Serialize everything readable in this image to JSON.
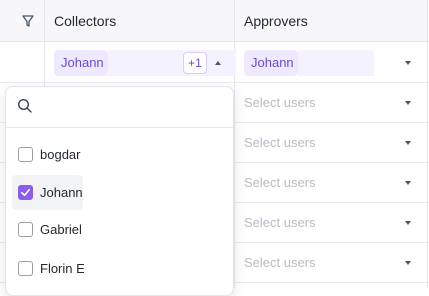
{
  "header": {
    "collectors_label": "Collectors",
    "approvers_label": "Approvers"
  },
  "row1": {
    "collector_chip": "Johann",
    "collector_more": "+1",
    "approver_chip": "Johann"
  },
  "approver_rows": [
    {
      "placeholder": "Select users"
    },
    {
      "placeholder": "Select users"
    },
    {
      "placeholder": "Select users"
    },
    {
      "placeholder": "Select users"
    },
    {
      "placeholder": "Select users"
    }
  ],
  "dropdown": {
    "search_value": "",
    "options": [
      {
        "label": "bogdar",
        "checked": false
      },
      {
        "label": "Johann",
        "checked": true
      },
      {
        "label": "Gabriel",
        "checked": false
      },
      {
        "label": "Florin E",
        "checked": false
      }
    ]
  },
  "colors": {
    "accent": "#8d5ce8",
    "chip_bg": "#efe9ff",
    "chip_text": "#6b4bd0"
  }
}
